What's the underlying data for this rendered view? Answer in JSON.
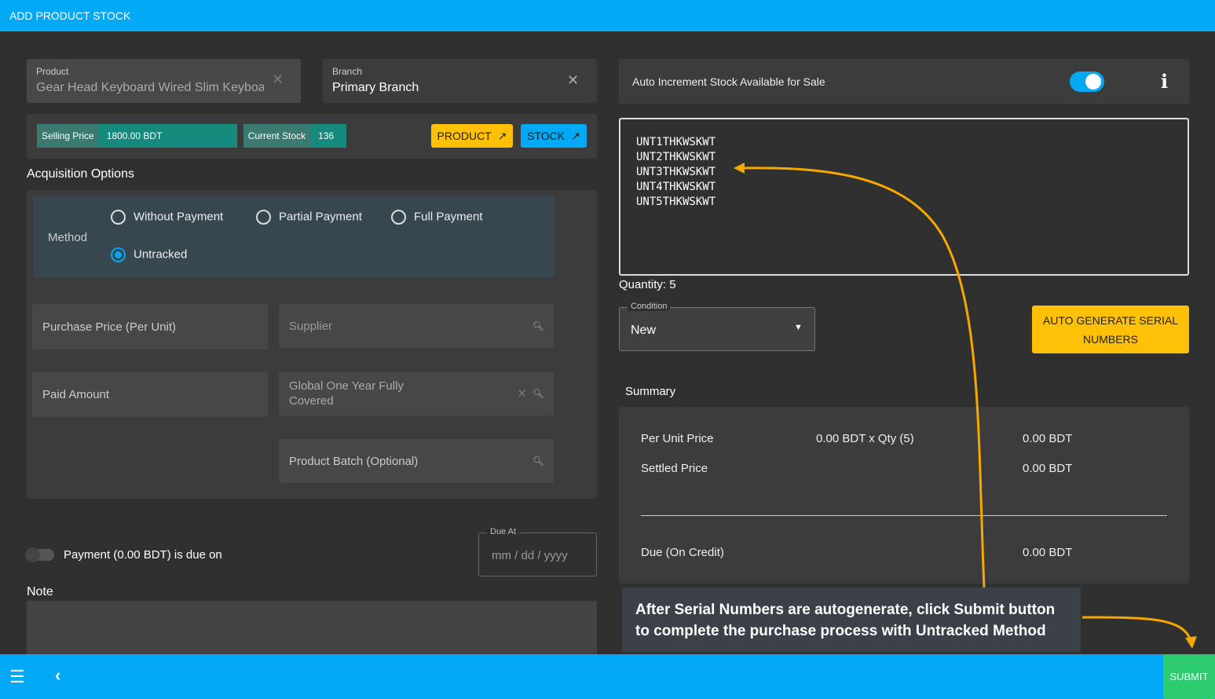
{
  "header": {
    "title": "ADD PRODUCT STOCK"
  },
  "product": {
    "label": "Product",
    "value": "Gear Head Keyboard Wired Slim Keyboar"
  },
  "branch": {
    "label": "Branch",
    "value": "Primary Branch"
  },
  "info": {
    "selling_price_label": "Selling Price",
    "selling_price": "1800.00 BDT",
    "current_stock_label": "Current Stock",
    "current_stock": "136",
    "product_button": "PRODUCT",
    "stock_button": "STOCK"
  },
  "acquisition": {
    "title": "Acquisition Options",
    "method_label": "Method",
    "options": [
      "Without Payment",
      "Partial Payment",
      "Full Payment",
      "Untracked"
    ],
    "selected": "Untracked"
  },
  "fields": {
    "purchase_price": "Purchase Price (Per Unit)",
    "supplier": "Supplier",
    "paid_amount": "Paid Amount",
    "warranty": "Global One Year Fully Covered",
    "batch": "Product Batch (Optional)"
  },
  "payment": {
    "toggle_label": "Payment (0.00 BDT) is due on",
    "due_label": "Due At",
    "due_placeholder": "mm / dd / yyyy",
    "toggle_on": false
  },
  "note": {
    "label": "Note"
  },
  "auto_increment": {
    "label": "Auto Increment Stock Available for Sale",
    "enabled": true
  },
  "serials": [
    "UNT1THKWSKWT",
    "UNT2THKWSKWT",
    "UNT3THKWSKWT",
    "UNT4THKWSKWT",
    "UNT5THKWSKWT"
  ],
  "quantity": "Quantity: 5",
  "condition": {
    "label": "Condition",
    "value": "New"
  },
  "auto_generate_button": "AUTO GENERATE SERIAL NUMBERS",
  "summary": {
    "title": "Summary",
    "per_unit_label": "Per Unit Price",
    "per_unit_calc": "0.00 BDT x Qty (5)",
    "per_unit_value": "0.00 BDT",
    "settled_label": "Settled Price",
    "settled_value": "0.00 BDT",
    "due_label": "Due (On Credit)",
    "due_value": "0.00 BDT"
  },
  "annotation": {
    "text_line1": "After Serial Numbers are autogenerate, click Submit button",
    "text_line2": "to complete the purchase process with Untracked Method",
    "arrow_color": "#f5a800"
  },
  "footer": {
    "submit": "SUBMIT"
  },
  "colors": {
    "primary": "#03a9f4",
    "warning": "#ffc107",
    "success": "#2ecc71",
    "teal": "#168a7c"
  }
}
